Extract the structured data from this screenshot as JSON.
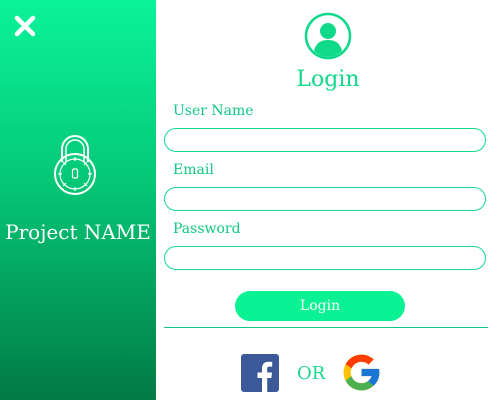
{
  "sidebar": {
    "close_icon": "close-icon",
    "lock_icon": "lock-icon",
    "project_name": "Project NAME"
  },
  "form": {
    "avatar_icon": "user-avatar-icon",
    "title": "Login",
    "fields": [
      {
        "label": "User Name",
        "value": "",
        "placeholder": ""
      },
      {
        "label": "Email",
        "value": "",
        "placeholder": ""
      },
      {
        "label": "Password",
        "value": "",
        "placeholder": ""
      }
    ],
    "submit_label": "Login",
    "or_text": "OR",
    "social": [
      "facebook-icon",
      "google-icon"
    ]
  },
  "colors": {
    "accent": "#0bf295",
    "sidebar_top": "#0bf39a",
    "sidebar_bottom": "#027a45",
    "facebook": "#3b5998"
  }
}
